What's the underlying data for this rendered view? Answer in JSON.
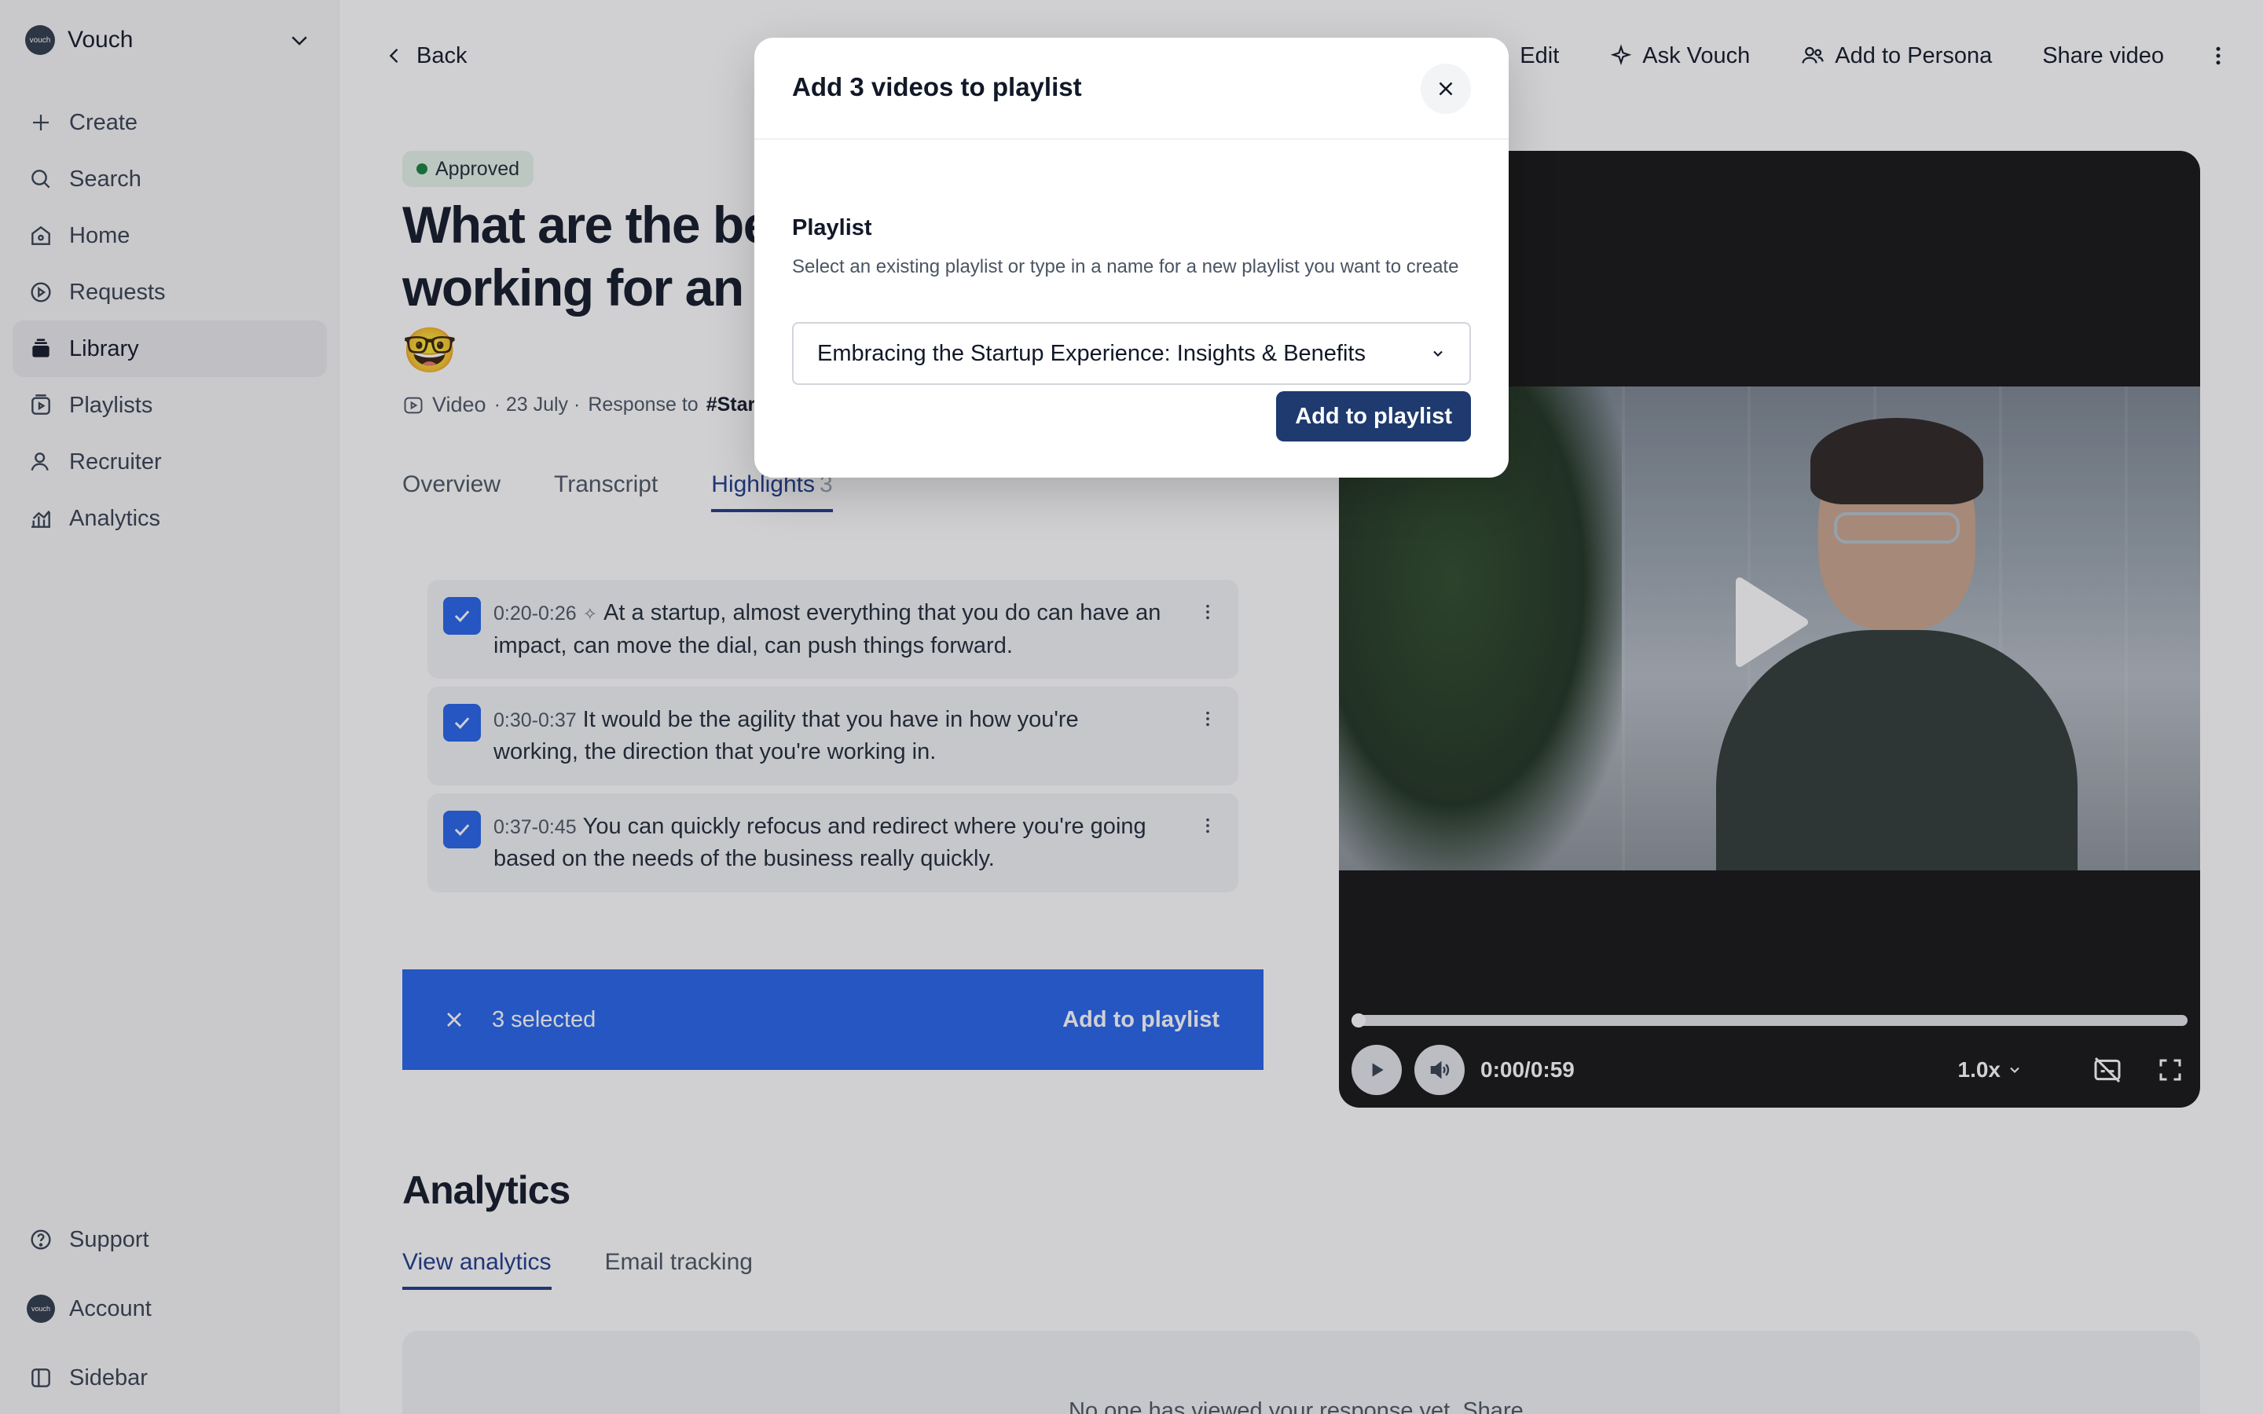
{
  "brand": {
    "name": "Vouch",
    "logo_text": "vouch"
  },
  "sidebar": {
    "items": [
      {
        "label": "Create",
        "icon": "plus-icon"
      },
      {
        "label": "Search",
        "icon": "search-icon"
      },
      {
        "label": "Home",
        "icon": "home-icon"
      },
      {
        "label": "Requests",
        "icon": "play-circle-icon"
      },
      {
        "label": "Library",
        "icon": "library-icon",
        "active": true
      },
      {
        "label": "Playlists",
        "icon": "playlist-icon"
      },
      {
        "label": "Recruiter",
        "icon": "recruiter-icon"
      },
      {
        "label": "Analytics",
        "icon": "analytics-icon"
      }
    ],
    "bottom": [
      {
        "label": "Support",
        "icon": "help-icon"
      },
      {
        "label": "Account",
        "icon": "avatar"
      },
      {
        "label": "Sidebar",
        "icon": "sidebar-icon"
      }
    ]
  },
  "topbar": {
    "back_label": "Back",
    "edit_label": "Edit",
    "ask_label": "Ask Vouch",
    "persona_label": "Add to Persona",
    "share_label": "Share video"
  },
  "video_page": {
    "badge": "Approved",
    "title_line1": "What are the bes",
    "title_line2": "working for an ea",
    "emoji": "🤓",
    "meta_type": "Video",
    "meta_date": "· 23 July ·",
    "meta_response": "Response to",
    "meta_tag": "#Star",
    "tabs": {
      "overview": "Overview",
      "transcript": "Transcript",
      "highlights": "Highlights",
      "highlights_count": "3"
    }
  },
  "highlights": [
    {
      "time": "0:20-0:26",
      "sparkle": "✧",
      "text": "At a startup, almost everything that you do can have an impact, can move the dial, can push things forward."
    },
    {
      "time": "0:30-0:37",
      "sparkle": "",
      "text": "It would be the agility that you have in how you're working, the direction that you're working in."
    },
    {
      "time": "0:37-0:45",
      "sparkle": "",
      "text": "You can quickly refocus and redirect where you're going based on the needs of the business really quickly."
    }
  ],
  "selection_bar": {
    "count_label": "3 selected",
    "action_label": "Add to playlist"
  },
  "analytics": {
    "heading": "Analytics",
    "tab_view": "View analytics",
    "tab_email": "Email tracking",
    "empty_text": "No one has viewed your response yet. Share"
  },
  "player": {
    "time": "0:00/0:59",
    "speed": "1.0x",
    "progress": 0.0
  },
  "modal": {
    "title": "Add 3 videos to playlist",
    "field_label": "Playlist",
    "field_help": "Select an existing playlist or type in a name for a new playlist you want to create",
    "selected_value": "Embracing the Startup Experience: Insights & Benefits",
    "submit_label": "Add to playlist"
  },
  "colors": {
    "accent": "#2563eb",
    "primary_button": "#1e3a6e",
    "tab_active": "#1e3a8a"
  }
}
